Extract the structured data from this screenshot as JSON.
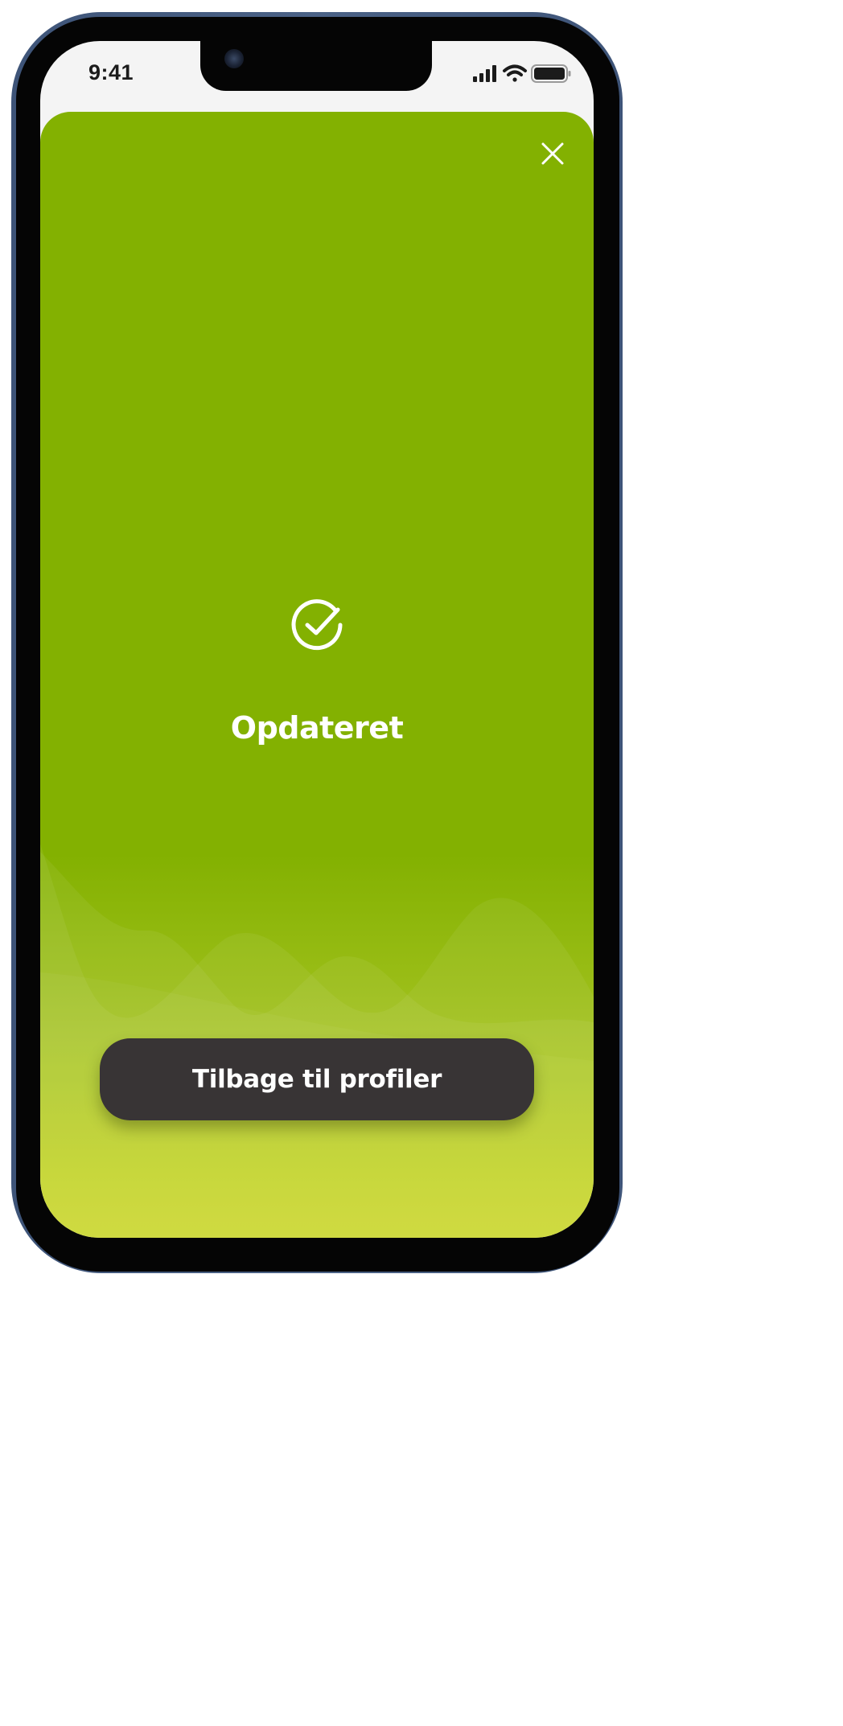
{
  "status_bar": {
    "time": "9:41",
    "signal_icon": "cellular-signal-icon",
    "wifi_icon": "wifi-icon",
    "battery_icon": "battery-icon"
  },
  "modal": {
    "close_icon": "close-icon",
    "status_icon": "check-circle-icon",
    "title": "Opdateret",
    "primary_button_label": "Tilbage til profiler"
  },
  "colors": {
    "accent_green": "#83b101",
    "bottom_yellow_green": "#c8d521",
    "button_dark": "#383435",
    "text_on_green": "#ffffff"
  }
}
